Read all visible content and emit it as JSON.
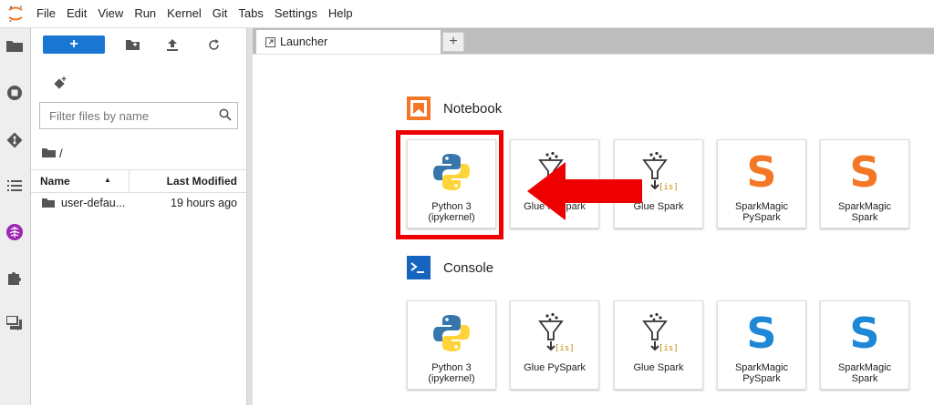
{
  "menubar": {
    "items": [
      "File",
      "Edit",
      "View",
      "Run",
      "Kernel",
      "Git",
      "Tabs",
      "Settings",
      "Help"
    ]
  },
  "filebrowser": {
    "new_label": "+",
    "filter_placeholder": "Filter files by name",
    "breadcrumb": "/",
    "columns": {
      "name": "Name",
      "modified": "Last Modified"
    },
    "files": [
      {
        "name": "user-defau...",
        "modified": "19 hours ago"
      }
    ]
  },
  "tabs": {
    "launcher_label": "Launcher",
    "add_label": "+"
  },
  "launcher": {
    "notebook_title": "Notebook",
    "console_title": "Console",
    "notebook_cards": [
      {
        "label_line1": "Python 3",
        "label_line2": "(ipykernel)",
        "icon": "python-icon"
      },
      {
        "label_line1": "Glue PySpark",
        "label_line2": "",
        "icon": "glue-icon"
      },
      {
        "label_line1": "Glue Spark",
        "label_line2": "",
        "icon": "glue-icon"
      },
      {
        "label_line1": "SparkMagic",
        "label_line2": "PySpark",
        "icon": "sparkmagic-icon"
      },
      {
        "label_line1": "SparkMagic",
        "label_line2": "Spark",
        "icon": "sparkmagic-icon"
      }
    ],
    "console_cards": [
      {
        "label_line1": "Python 3",
        "label_line2": "(ipykernel)",
        "icon": "python-icon"
      },
      {
        "label_line1": "Glue PySpark",
        "label_line2": "",
        "icon": "glue-icon"
      },
      {
        "label_line1": "Glue Spark",
        "label_line2": "",
        "icon": "glue-icon"
      },
      {
        "label_line1": "SparkMagic",
        "label_line2": "PySpark",
        "icon": "sparkmagic-icon"
      },
      {
        "label_line1": "SparkMagic",
        "label_line2": "Spark",
        "icon": "sparkmagic-icon"
      }
    ],
    "glue_badge": "[is]:",
    "spark_letter": "S"
  },
  "colors": {
    "accent": "#1976d2",
    "highlight": "#ee0000",
    "notebook_icon": "#f37726",
    "spark_notebook": "#f37726",
    "spark_console": "#1e88d6"
  }
}
